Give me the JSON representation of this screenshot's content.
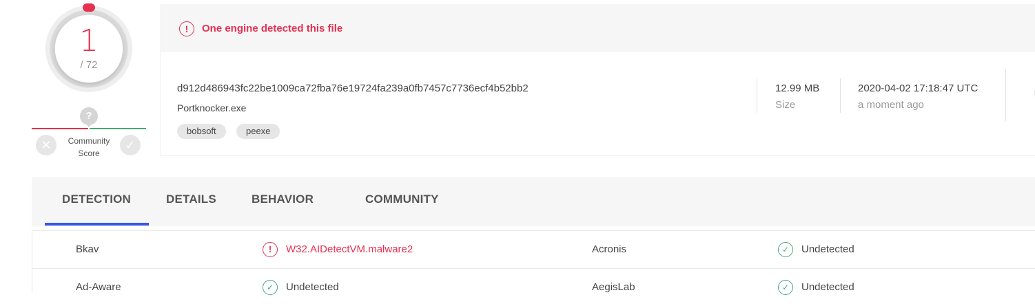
{
  "score": {
    "detections": "1",
    "total": "/ 72"
  },
  "community": {
    "label_line1": "Community",
    "label_line2": "Score",
    "question": "?",
    "dislike": "✕",
    "like": "✓"
  },
  "alert": {
    "icon": "!",
    "text": "One engine detected this file",
    "color": "#e5304f"
  },
  "file": {
    "hash": "d912d486943fc22be1009ca72fba76e19724fa239a0fb7457c7736ecf4b52bb2",
    "name": "Portknocker.exe",
    "tags": [
      "bobsoft",
      "peexe"
    ],
    "size_value": "12.99 MB",
    "size_label": "Size",
    "date_value": "2020-04-02 17:18:47 UTC",
    "date_label": "a moment ago"
  },
  "tabs": [
    {
      "label": "DETECTION",
      "active": true
    },
    {
      "label": "DETAILS",
      "active": false
    },
    {
      "label": "BEHAVIOR",
      "active": false
    },
    {
      "label": "COMMUNITY",
      "active": false
    }
  ],
  "results": [
    {
      "engine_a": "Bkav",
      "result_a": "W32.AIDetectVM.malware2",
      "status_a": "malicious",
      "engine_b": "Acronis",
      "result_b": "Undetected",
      "status_b": "undetected"
    },
    {
      "engine_a": "Ad-Aware",
      "result_a": "Undetected",
      "status_a": "undetected",
      "engine_b": "AegisLab",
      "result_b": "Undetected",
      "status_b": "undetected"
    }
  ],
  "colors": {
    "malicious": "#e5304f",
    "clean": "#44a87c",
    "accent": "#3b55e6"
  },
  "icons": {
    "malicious": "exclamation-circle-icon",
    "undetected": "check-circle-icon"
  }
}
